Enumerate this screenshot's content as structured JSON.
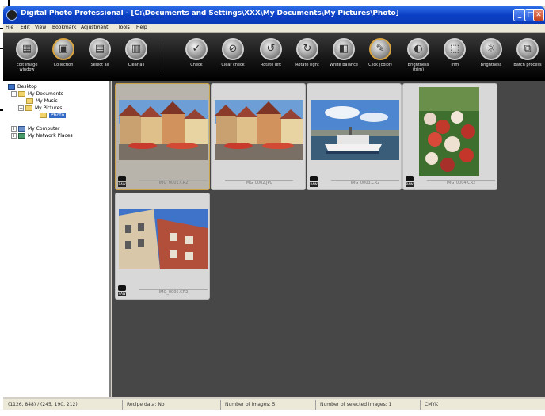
{
  "window": {
    "title": "Digital Photo Professional - [C:\\Documents and Settings\\XXX\\My Documents\\My Pictures\\Photo]",
    "min_label": "_",
    "max_label": "□",
    "close_label": "✕"
  },
  "menu": [
    "File",
    "Edit",
    "View",
    "Bookmark",
    "Adjustment",
    "Tools",
    "Help"
  ],
  "toolbar": [
    {
      "label": "Edit image window",
      "glyph": "▦"
    },
    {
      "label": "Collection",
      "glyph": "▣",
      "active": true
    },
    {
      "label": "Select all",
      "glyph": "▤"
    },
    {
      "label": "Clear all",
      "glyph": "▥"
    },
    {
      "label": "Check",
      "glyph": "✓"
    },
    {
      "label": "Clear check",
      "glyph": "⊘"
    },
    {
      "label": "Rotate left",
      "glyph": "↺"
    },
    {
      "label": "Rotate right",
      "glyph": "↻"
    },
    {
      "label": "White balance",
      "glyph": "◧"
    },
    {
      "label": "Click (color)",
      "glyph": "✎",
      "active": true
    },
    {
      "label": "Brightness (trim)",
      "glyph": "◐"
    },
    {
      "label": "Trim",
      "glyph": "⬚"
    },
    {
      "label": "Brightness",
      "glyph": "☼"
    },
    {
      "label": "Batch process",
      "glyph": "⧉"
    }
  ],
  "tree": [
    {
      "label": "Desktop",
      "expander": "",
      "icon": "desk"
    },
    {
      "label": "My Documents",
      "expander": "−",
      "icon": "fold"
    },
    {
      "label": "My Music",
      "expander": "",
      "icon": "fold"
    },
    {
      "label": "My Pictures",
      "expander": "−",
      "icon": "fold"
    },
    {
      "label": "Photo",
      "expander": "",
      "icon": "fold",
      "selected": true
    },
    {
      "label": "My Computer",
      "expander": "+",
      "icon": "comp"
    },
    {
      "label": "My Network Places",
      "expander": "+",
      "icon": "net"
    }
  ],
  "thumbnails": [
    {
      "filename": "IMG_0001.CR2",
      "scene": "town-square",
      "selected": true,
      "edited": true
    },
    {
      "filename": "IMG_0002.JPG",
      "scene": "town-square-2",
      "selected": false,
      "edited": false
    },
    {
      "filename": "IMG_0003.CR2",
      "scene": "harbor",
      "selected": false,
      "edited": true
    },
    {
      "filename": "IMG_0004.CR2",
      "scene": "flowers",
      "selected": false,
      "edited": true
    },
    {
      "filename": "IMG_0005.CR2",
      "scene": "building",
      "selected": false,
      "edited": true
    }
  ],
  "raw_badge": "RAW",
  "status": {
    "coords": "(1126, 848) / (245, 190, 212)",
    "recipe": "Recipe data: No",
    "images": "Number of images: 5",
    "selected": "Number of selected images: 1",
    "color": "CMYK"
  }
}
